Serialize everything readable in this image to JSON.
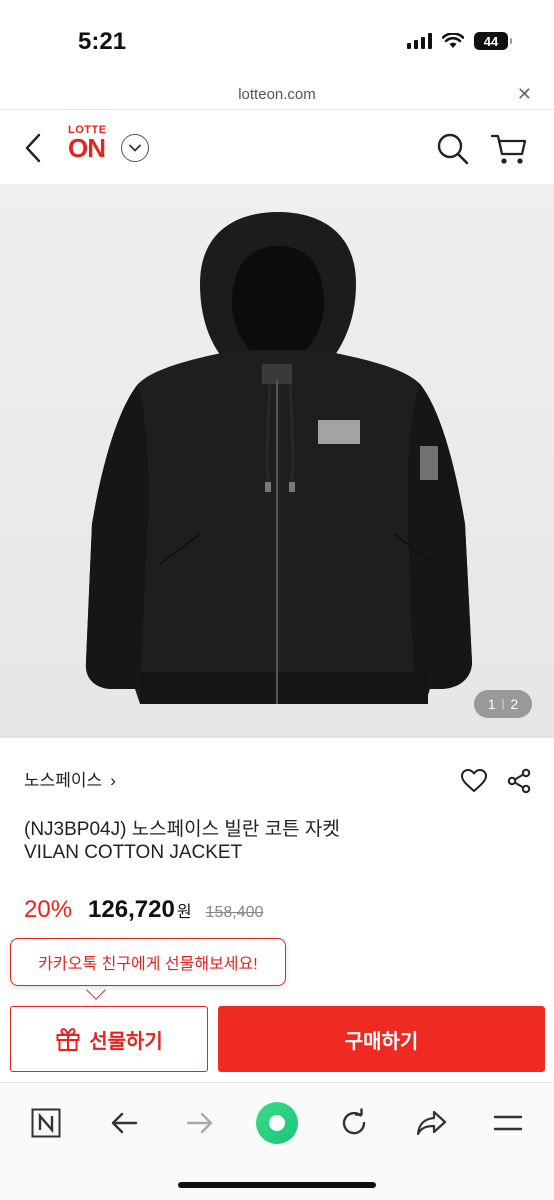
{
  "status_bar": {
    "time": "5:21",
    "battery": "44"
  },
  "browser": {
    "url": "lotteon.com",
    "close_label": "✕"
  },
  "header": {
    "logo_top": "LOTTE",
    "logo_main": "ON"
  },
  "gallery": {
    "current": "1",
    "separator": "|",
    "total": "2"
  },
  "product": {
    "brand": "노스페이스",
    "brand_chevron": "›",
    "title_line1": "(NJ3BP04J) 노스페이스 빌란 코튼 자켓",
    "title_line2": "VILAN COTTON JACKET",
    "discount": "20%",
    "price": "126,720",
    "currency": "원",
    "original_price": "158,400"
  },
  "tooltip": {
    "text": "카카오톡 친구에게 선물해보세요!"
  },
  "actions": {
    "gift_label": "선물하기",
    "buy_label": "구매하기"
  },
  "colors": {
    "accent": "#e8231f",
    "buy": "#ee2a23",
    "reload_green": "#3ddc84"
  }
}
